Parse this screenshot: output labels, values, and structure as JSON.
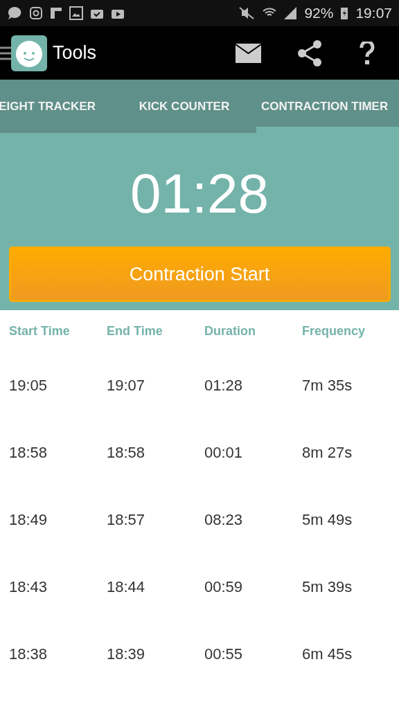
{
  "status_bar": {
    "battery": "92%",
    "time": "19:07"
  },
  "app_bar": {
    "title": "Tools"
  },
  "tabs": [
    {
      "label": "EIGHT TRACKER",
      "selected": false
    },
    {
      "label": "KICK COUNTER",
      "selected": false
    },
    {
      "label": "CONTRACTION TIMER",
      "selected": true
    }
  ],
  "timer": {
    "value": "01:28"
  },
  "start_button": {
    "label": "Contraction Start"
  },
  "table": {
    "columns": [
      "Start Time",
      "End Time",
      "Duration",
      "Frequency"
    ],
    "rows": [
      [
        "19:05",
        "19:07",
        "01:28",
        "7m 35s"
      ],
      [
        "18:58",
        "18:58",
        "00:01",
        "8m 27s"
      ],
      [
        "18:49",
        "18:57",
        "08:23",
        "5m 49s"
      ],
      [
        "18:43",
        "18:44",
        "00:59",
        "5m 39s"
      ],
      [
        "18:38",
        "18:39",
        "00:55",
        "6m 45s"
      ]
    ]
  }
}
